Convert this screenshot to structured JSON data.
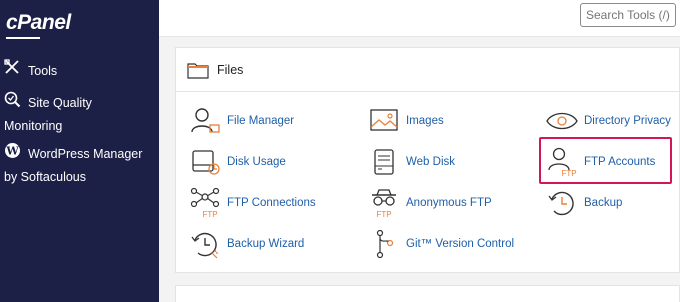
{
  "sidebar": {
    "logo": "cPanel",
    "items": [
      {
        "label": "Tools",
        "icon": "tools-icon"
      },
      {
        "label_line1": "Site Quality",
        "label_line2": "Monitoring",
        "icon": "magnifier-icon"
      },
      {
        "label_line1": "WordPress Manager",
        "label_line2": "by Softaculous",
        "icon": "wordpress-icon"
      }
    ]
  },
  "search": {
    "placeholder": "Search Tools (/)"
  },
  "files_panel": {
    "title": "Files",
    "items": [
      {
        "label": "File Manager",
        "icon": "file-manager-icon"
      },
      {
        "label": "Images",
        "icon": "images-icon"
      },
      {
        "label": "Directory Privacy",
        "icon": "directory-privacy-icon"
      },
      {
        "label": "Disk Usage",
        "icon": "disk-usage-icon"
      },
      {
        "label": "Web Disk",
        "icon": "web-disk-icon"
      },
      {
        "label": "FTP Accounts",
        "icon": "ftp-accounts-icon"
      },
      {
        "label": "FTP Connections",
        "icon": "ftp-connections-icon"
      },
      {
        "label": "Anonymous FTP",
        "icon": "anonymous-ftp-icon"
      },
      {
        "label": "Backup",
        "icon": "backup-icon"
      },
      {
        "label": "Backup Wizard",
        "icon": "backup-wizard-icon"
      },
      {
        "label": "Git™ Version Control",
        "icon": "git-icon"
      }
    ]
  },
  "colors": {
    "sidebar_bg": "#1d2046",
    "link": "#1f5fa8",
    "accent": "#e8803a",
    "highlight": "#d5155a"
  }
}
